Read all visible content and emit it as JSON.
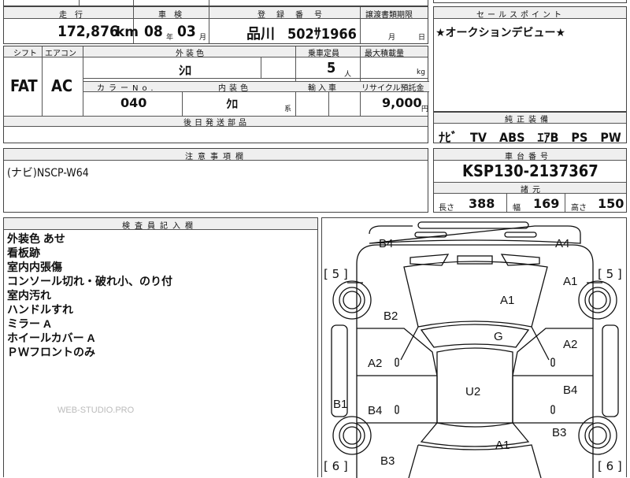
{
  "top_row": {
    "mileage_header": "走　行",
    "inspection_header": "車　検",
    "registration_header": "登　録　番　号",
    "transfer_header": "譲渡書類期限",
    "mileage_value": "172,876",
    "mileage_unit": "km",
    "inspection_year": "08",
    "inspection_year_unit": "年",
    "inspection_month": "03",
    "inspection_month_unit": "月",
    "registration_area": "品川",
    "registration_number": "502ｻ1966",
    "transfer_month_unit": "月",
    "transfer_day_unit": "日"
  },
  "sales_point": {
    "header": "セールスポイント",
    "text": "★オークションデビュー★"
  },
  "specs": {
    "shift_header": "シフト",
    "ac_header": "エアコン",
    "exterior_header": "外装色",
    "capacity_header": "乗車定員",
    "max_load_header": "最大積載量",
    "shift_value": "FAT",
    "ac_value": "AC",
    "exterior_value": "ｼﾛ",
    "capacity_value": "5",
    "capacity_unit": "人",
    "max_load_unit": "kg",
    "color_no_header": "カラーNo.",
    "interior_header": "内装色",
    "import_header": "輸入車",
    "recycle_header": "リサイクル預託金",
    "color_no_value": "040",
    "interior_value": "ｸﾛ",
    "interior_unit": "系",
    "recycle_value": "9,000",
    "recycle_unit": "円",
    "parts_header": "後日発送部品"
  },
  "equipment": {
    "header": "純正装備",
    "items": "ﾅﾋﾞ　TV　ABS　ｴｱB　PS　PW"
  },
  "notes": {
    "header": "注意事項欄",
    "text": "(ナビ)NSCP-W64"
  },
  "chassis": {
    "header": "車台番号",
    "number": "KSP130-2137367",
    "dims_header": "諸元",
    "length_label": "長さ",
    "length_value": "388",
    "width_label": "幅",
    "width_value": "169",
    "height_label": "高さ",
    "height_value": "150"
  },
  "inspector": {
    "header": "検査員記入欄",
    "lines": [
      "外装色 あせ",
      "看板跡",
      "室内内張傷",
      "コンソール切れ・破れ小、のり付",
      "室内汚れ",
      "ハンドルすれ",
      "ミラー A",
      "ホイールカバー A",
      "ＰＷフロントのみ"
    ],
    "watermark": "WEB-STUDIO.PRO"
  },
  "diagram": {
    "bracket_left_top": "[ 5 ]",
    "bracket_right_top": "[ 5 ]",
    "bracket_left_bottom": "[ 6 ]",
    "bracket_right_bottom": "[ 6 ]",
    "marks": {
      "b4_top": "B4",
      "a4_top": "A4",
      "a1_right": "A1",
      "a1_hood": "A1",
      "b2": "B2",
      "g": "G",
      "a2_right": "A2",
      "a2_left": "A2",
      "u2": "U2",
      "b4_right": "B4",
      "b1": "B1",
      "b4_left": "B4",
      "b3_right": "B3",
      "a1_rear": "A1",
      "b3_left": "B3"
    }
  }
}
